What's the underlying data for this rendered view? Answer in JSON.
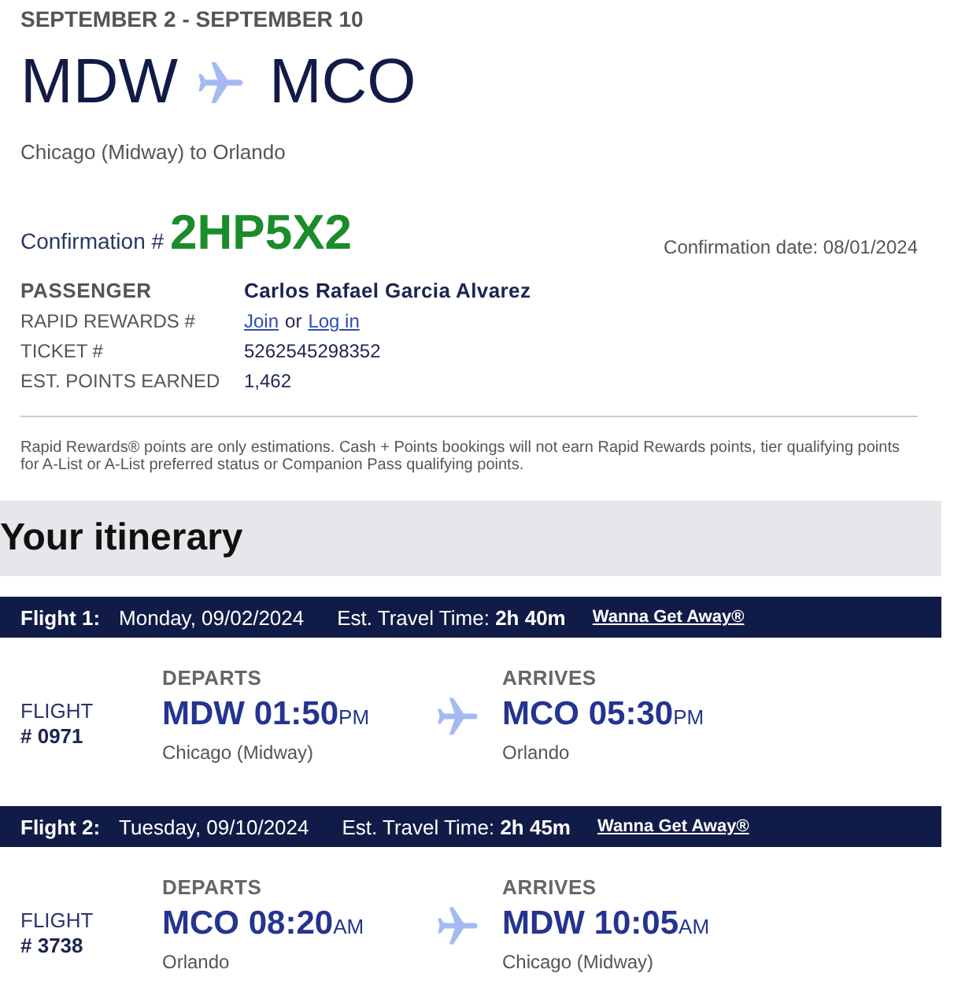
{
  "trip": {
    "dates": "SEPTEMBER 2 - SEPTEMBER 10",
    "origin": "MDW",
    "destination": "MCO",
    "description": "Chicago (Midway) to Orlando"
  },
  "confirmation": {
    "label": "Confirmation #",
    "code": "2HP5X2",
    "date": "Confirmation date: 08/01/2024"
  },
  "passenger_details": [
    {
      "kind": "name",
      "label": "PASSENGER",
      "value": "Carlos Rafael Garcia Alvarez"
    },
    {
      "kind": "links",
      "label": "RAPID REWARDS #",
      "links": [
        "Join",
        "Log in"
      ],
      "separator": "or"
    },
    {
      "kind": "text",
      "label": "TICKET #",
      "value": "5262545298352"
    },
    {
      "kind": "text",
      "label": "EST. POINTS EARNED",
      "value": "1,462"
    }
  ],
  "disclaimer": "Rapid Rewards® points are only estimations. Cash + Points bookings will not earn Rapid Rewards points, tier qualifying points for A-List or A-List preferred status or Companion Pass qualifying points.",
  "itinerary": {
    "title": "Your itinerary",
    "flights": [
      {
        "label": "Flight 1:",
        "date": "Monday, 09/02/2024",
        "travel_time_label": "Est. Travel Time:",
        "travel_time": "2h 40m",
        "fare": "Wanna Get Away®",
        "flight_label": "FLIGHT",
        "flight_number": "# 0971",
        "departs": {
          "label": "DEPARTS",
          "airport": "MDW",
          "time": "01:50",
          "period": "PM",
          "city": "Chicago (Midway)"
        },
        "arrives": {
          "label": "ARRIVES",
          "airport": "MCO",
          "time": "05:30",
          "period": "PM",
          "city": "Orlando"
        }
      },
      {
        "label": "Flight 2:",
        "date": "Tuesday, 09/10/2024",
        "travel_time_label": "Est. Travel Time:",
        "travel_time": "2h 45m",
        "fare": "Wanna Get Away®",
        "flight_label": "FLIGHT",
        "flight_number": "# 3738",
        "departs": {
          "label": "DEPARTS",
          "airport": "MCO",
          "time": "08:20",
          "period": "AM",
          "city": "Orlando"
        },
        "arrives": {
          "label": "ARRIVES",
          "airport": "MDW",
          "time": "10:05",
          "period": "AM",
          "city": "Chicago (Midway)"
        }
      }
    ]
  }
}
